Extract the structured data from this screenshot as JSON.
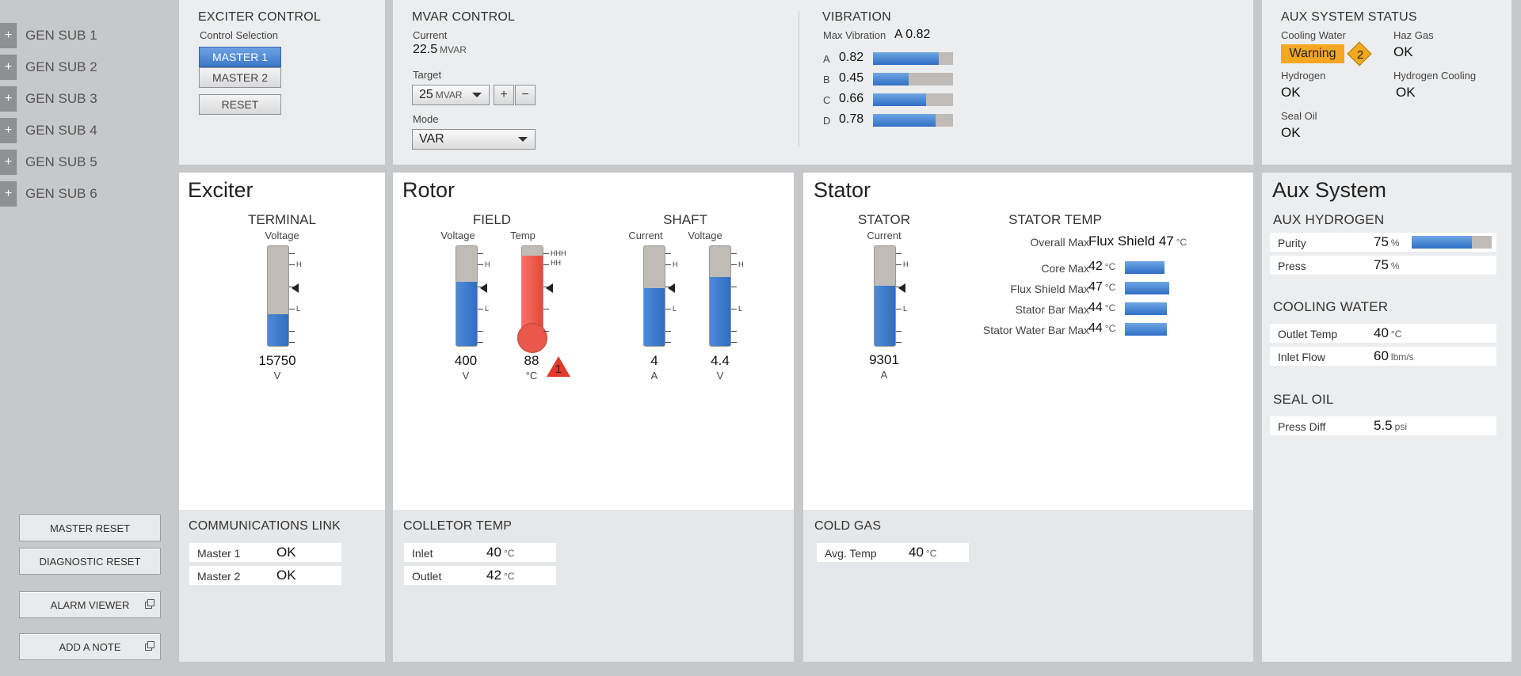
{
  "nav": {
    "items": [
      {
        "icon": "plus-icon",
        "label": "GEN SUB 1"
      },
      {
        "icon": "plus-icon",
        "label": "GEN SUB 2"
      },
      {
        "icon": "plus-icon",
        "label": "GEN SUB 3"
      },
      {
        "icon": "plus-icon",
        "label": "GEN SUB 4"
      },
      {
        "icon": "plus-icon",
        "label": "GEN SUB 5"
      },
      {
        "icon": "plus-icon",
        "label": "GEN SUB 6"
      }
    ],
    "plus_glyph": "+",
    "buttons": {
      "master_reset": "MASTER RESET",
      "diagnostic_reset": "DIAGNOSTIC RESET",
      "alarm_viewer": "ALARM VIEWER",
      "add_note": "ADD A NOTE"
    }
  },
  "exciter_control": {
    "title": "EXCITER CONTROL",
    "selection_label": "Control Selection",
    "master1": "MASTER 1",
    "master2": "MASTER 2",
    "selected": "MASTER 1",
    "reset": "RESET"
  },
  "mvar_control": {
    "title": "MVAR CONTROL",
    "current_label": "Current",
    "current_value": "22.5",
    "current_unit": "MVAR",
    "target_label": "Target",
    "target_value": "25",
    "target_unit": "MVAR",
    "plus": "+",
    "minus": "−",
    "mode_label": "Mode",
    "mode_value": "VAR"
  },
  "vibration": {
    "title": "VIBRATION",
    "max_label": "Max Vibration",
    "max_value": "A 0.82",
    "items": [
      {
        "label": "A",
        "value": "0.82",
        "level": 0.82
      },
      {
        "label": "B",
        "value": "0.45",
        "level": 0.45
      },
      {
        "label": "C",
        "value": "0.66",
        "level": 0.66
      },
      {
        "label": "D",
        "value": "0.78",
        "level": 0.78
      }
    ]
  },
  "aux_status": {
    "title": "AUX SYSTEM STATUS",
    "cooling_water_label": "Cooling Water",
    "cooling_water_value": "Warning",
    "cooling_water_badge": "2",
    "haz_gas_label": "Haz Gas",
    "haz_gas_value": "OK",
    "hydrogen_label": "Hydrogen",
    "hydrogen_value": "OK",
    "hydrogen_cooling_label": "Hydrogen Cooling",
    "hydrogen_cooling_value": "OK",
    "seal_oil_label": "Seal Oil",
    "seal_oil_value": "OK",
    "colors": {
      "warning": "#f5a623",
      "badge": "#f0a81c"
    }
  },
  "exciter": {
    "title": "Exciter",
    "terminal_label": "TERMINAL",
    "voltage_label": "Voltage",
    "voltage_value": "15750",
    "voltage_unit": "V",
    "voltage_level": 0.32,
    "tick_h": "H",
    "tick_l": "L"
  },
  "rotor": {
    "title": "Rotor",
    "field_label": "FIELD",
    "shaft_label": "SHAFT",
    "field_voltage_label": "Voltage",
    "field_voltage_value": "400",
    "field_voltage_unit": "V",
    "field_voltage_level": 0.64,
    "field_temp_label": "Temp",
    "field_temp_value": "88",
    "field_temp_unit": "°C",
    "field_temp_level": 0.9,
    "alarm_badge": "1",
    "tick_hhh": "HHH",
    "tick_hh": "HH",
    "shaft_current_label": "Current",
    "shaft_current_value": "4",
    "shaft_current_unit": "A",
    "shaft_current_level": 0.58,
    "shaft_voltage_label": "Voltage",
    "shaft_voltage_value": "4.4",
    "shaft_voltage_unit": "V",
    "shaft_voltage_level": 0.69
  },
  "stator": {
    "title": "Stator",
    "stator_label": "STATOR",
    "current_label": "Current",
    "current_value": "9301",
    "current_unit": "A",
    "current_level": 0.6,
    "temp_title": "STATOR TEMP",
    "overall_max_label": "Overall Max",
    "overall_max_value": "Flux Shield 47",
    "overall_max_unit": "°C",
    "rows": [
      {
        "label": "Core Max",
        "value": "42",
        "unit": "°C",
        "level": 0.42
      },
      {
        "label": "Flux Shield Max",
        "value": "47",
        "unit": "°C",
        "level": 0.47
      },
      {
        "label": "Stator Bar Max",
        "value": "44",
        "unit": "°C",
        "level": 0.44
      },
      {
        "label": "Stator Water Bar Max",
        "value": "44",
        "unit": "°C",
        "level": 0.44
      }
    ]
  },
  "aux_system": {
    "title": "Aux System",
    "hydrogen_title": "AUX HYDROGEN",
    "purity_label": "Purity",
    "purity_value": "75",
    "purity_unit": "%",
    "purity_level": 0.75,
    "press_label": "Press",
    "press_value": "75",
    "press_unit": "%",
    "cooling_title": "COOLING WATER",
    "outlet_label": "Outlet Temp",
    "outlet_value": "40",
    "outlet_unit": "°C",
    "inlet_label": "Inlet Flow",
    "inlet_value": "60",
    "inlet_unit": "lbm/s",
    "seal_title": "SEAL OIL",
    "press_diff_label": "Press Diff",
    "press_diff_value": "5.5",
    "press_diff_unit": "psi"
  },
  "comms": {
    "title": "COMMUNICATIONS LINK",
    "master1_label": "Master 1",
    "master1_value": "OK",
    "master2_label": "Master 2",
    "master2_value": "OK"
  },
  "collector": {
    "title": "COLLETOR TEMP",
    "inlet_label": "Inlet",
    "inlet_value": "40",
    "inlet_unit": "°C",
    "outlet_label": "Outlet",
    "outlet_value": "42",
    "outlet_unit": "°C"
  },
  "cold_gas": {
    "title": "COLD GAS",
    "avg_label": "Avg. Temp",
    "avg_value": "40",
    "avg_unit": "°C"
  }
}
